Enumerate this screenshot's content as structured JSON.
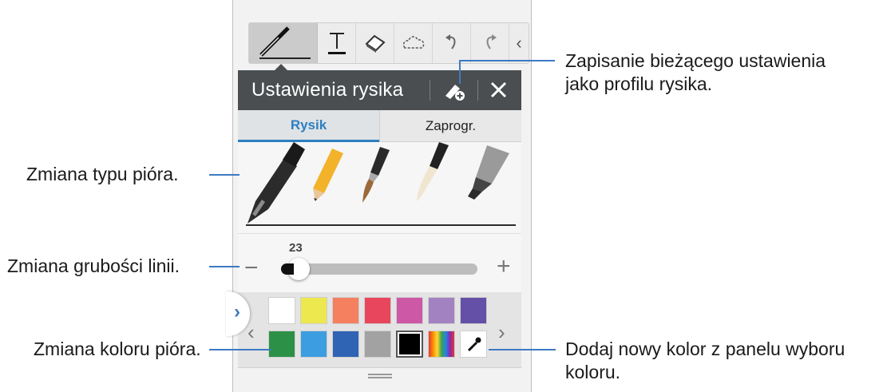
{
  "toolbar": {
    "tools": [
      "pen-tool",
      "text-tool",
      "eraser-tool",
      "selection-tool",
      "undo",
      "redo",
      "collapse"
    ]
  },
  "panel": {
    "title": "Ustawienia rysika",
    "tabs": [
      {
        "label": "Rysik",
        "active": true
      },
      {
        "label": "Zaprogr.",
        "active": false
      }
    ],
    "pen_types": [
      "ballpoint-pen",
      "pencil",
      "brush",
      "calligraphy-brush",
      "marker"
    ],
    "thickness": {
      "value": "23",
      "minus": "−",
      "plus": "+",
      "level": 0.23
    },
    "colors_row1": [
      "#ffffff",
      "#ece84e",
      "#f48060",
      "#e8465c",
      "#cc58a6",
      "#a382c2",
      "#6450a6"
    ],
    "colors_row2": [
      "#2c9146",
      "#3c9de0",
      "#2f63b4",
      "#a2a2a2",
      "#000000",
      "rainbow",
      "eyedropper"
    ]
  },
  "annotations": {
    "save_profile": [
      "Zapisanie bieżącego ustawienia",
      "jako profilu rysika."
    ],
    "pen_type": "Zmiana typu pióra.",
    "line_thickness": "Zmiana grubości linii.",
    "pen_color": "Zmiana koloru pióra.",
    "add_color": [
      "Dodaj nowy kolor z panelu wyboru",
      "koloru."
    ]
  },
  "accent_color": "#3d7ac4"
}
